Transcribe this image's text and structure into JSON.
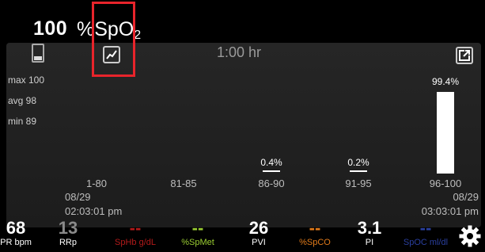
{
  "header": {
    "value": "100",
    "param_main": "%SpO",
    "param_sub": "2"
  },
  "panel": {
    "duration": "1:00 hr",
    "stats": {
      "max": "max 100",
      "avg": "avg 98",
      "min": "min 89"
    }
  },
  "chart_data": {
    "type": "bar",
    "categories": [
      "1-80",
      "81-85",
      "86-90",
      "91-95",
      "96-100"
    ],
    "values": [
      0,
      0,
      0.4,
      0.2,
      99.4
    ],
    "labels": [
      "",
      "",
      "0.4%",
      "0.2%",
      "99.4%"
    ],
    "title": "",
    "xlabel": "",
    "ylabel": "",
    "ylim": [
      0,
      100
    ]
  },
  "time_range": {
    "start_date": "08/29",
    "start_time": "02:03:01 pm",
    "end_date": "08/29",
    "end_time": "03:03:01 pm"
  },
  "params": [
    {
      "value": "68",
      "label": "PR bpm",
      "value_color": "#ffffff",
      "label_color": "#ffffff"
    },
    {
      "value": "13",
      "label": "RRp",
      "value_color": "#8a8a8a",
      "label_color": "#ffffff"
    },
    {
      "value": "--",
      "label": "SpHb g/dL",
      "value_color": "#b31a1a",
      "label_color": "#b31a1a"
    },
    {
      "value": "--",
      "label": "%SpMet",
      "value_color": "#9acd32",
      "label_color": "#9acd32"
    },
    {
      "value": "26",
      "label": "PVI",
      "value_color": "#ffffff",
      "label_color": "#ffffff"
    },
    {
      "value": "--",
      "label": "%SpCO",
      "value_color": "#e07a1a",
      "label_color": "#e07a1a"
    },
    {
      "value": "3.1",
      "label": "PI",
      "value_color": "#ffffff",
      "label_color": "#ffffff"
    },
    {
      "value": "--",
      "label": "SpOC ml/dl",
      "value_color": "#2a3f9e",
      "label_color": "#2a3f9e"
    }
  ],
  "colors": {
    "highlight": "#e8242b",
    "bar": "#ffffff",
    "background": "#000000"
  },
  "icons": {
    "battery": "battery-icon",
    "trend": "trend-chart-icon",
    "export": "export-icon",
    "settings": "gear-icon"
  }
}
